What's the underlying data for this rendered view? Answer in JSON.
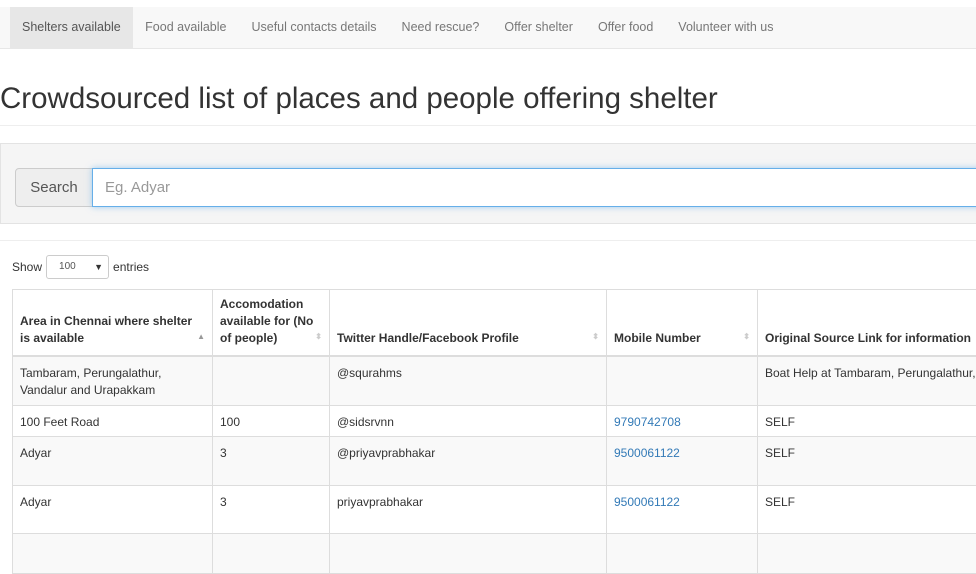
{
  "nav": {
    "items": [
      "Shelters available",
      "Food available",
      "Useful contacts details",
      "Need rescue?",
      "Offer shelter",
      "Offer food",
      "Volunteer with us"
    ],
    "active": 0
  },
  "title": "Crowdsourced list of places and people offering shelter",
  "search": {
    "label": "Search",
    "placeholder": "Eg. Adyar",
    "value": ""
  },
  "length": {
    "show": "Show",
    "value": "100",
    "entries": "entries"
  },
  "table": {
    "columns": [
      "Area in Chennai where shelter is available",
      "Accomodation available for (No of people)",
      "Twitter Handle/Facebook Profile",
      "Mobile Number",
      "Original Source Link for information"
    ],
    "sorted_column": 0,
    "sort_direction": "ascending",
    "rows": [
      [
        "Tambaram, Perungalathur, Vandalur and Urapakkam",
        "",
        "@squrahms",
        "",
        "Boat Help at Tambaram, Perungalathur,"
      ],
      [
        "100 Feet Road",
        "100",
        "@sidsrvnn",
        "9790742708",
        "SELF"
      ],
      [
        "Adyar",
        "3",
        "@priyavprabhakar",
        "9500061122",
        "SELF"
      ],
      [
        "Adyar",
        "3",
        "priyavprabhakar",
        "9500061122",
        "SELF"
      ]
    ]
  },
  "colors": {
    "link": "#337ab7",
    "nav_bg": "#f8f8f8",
    "focus": "#66afe9"
  }
}
